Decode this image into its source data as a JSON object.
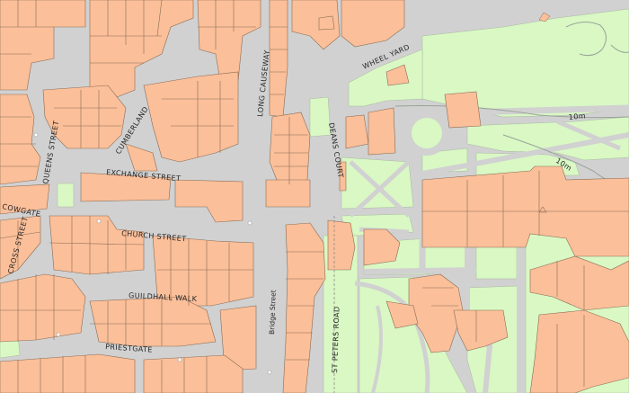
{
  "map": {
    "colors": {
      "road": "#d1d1d1",
      "building": "#fbbf99",
      "green": "#d9f8c4",
      "outline": "#8a6c55",
      "label": "#262626",
      "contour": "#9aa39a"
    },
    "labels": {
      "queens_street": "QUEENS STREET",
      "cumberland": "CUMBERLAND",
      "exchange_street": "EXCHANGE STREET",
      "cowgate": "COWGATE",
      "cross_street": "CROSS STREET",
      "church_street": "CHURCH STREET",
      "guildhall_walk": "GUILDHALL WALK",
      "priestgate": "PRIESTGATE",
      "long_causeway": "LONG CAUSEWAY",
      "bridge_street": "Bridge Street",
      "deans_court": "DEANS COURT",
      "wheel_yard": "WHEEL YARD",
      "st_peters_road": "ST PETERS ROAD",
      "contour_10m_a": "10m",
      "contour_10m_b": "10m"
    }
  }
}
